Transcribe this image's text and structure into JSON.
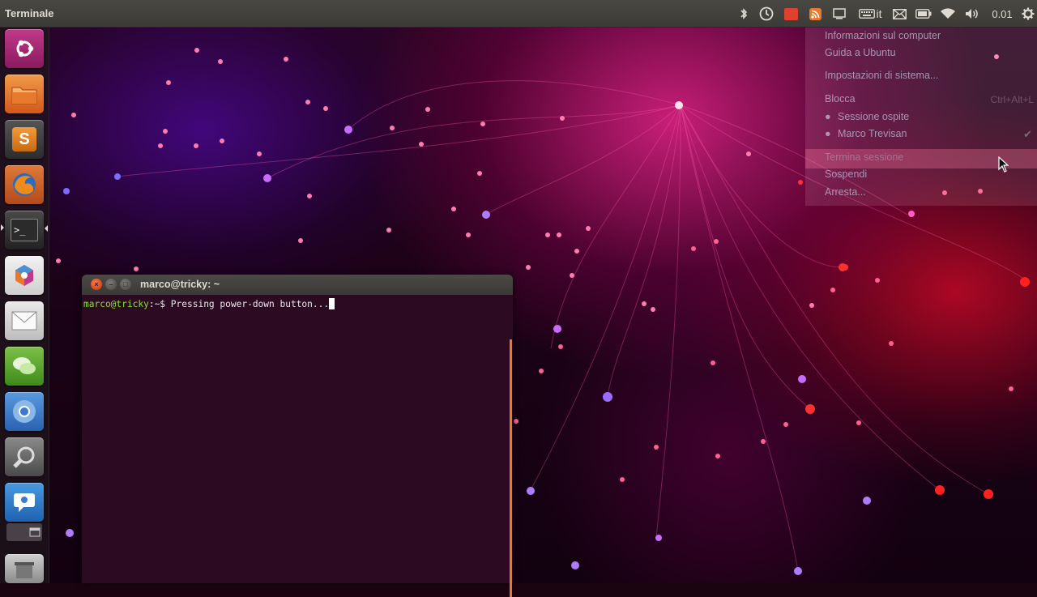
{
  "panel": {
    "app_title": "Terminale",
    "keyboard_layout": "it",
    "clock": "0.01"
  },
  "launcher": {
    "items": [
      {
        "name": "dash-home",
        "icon": "ubuntu-logo-icon"
      },
      {
        "name": "home-folder",
        "icon": "folder-icon"
      },
      {
        "name": "sublime-text",
        "icon": "sublime-s-icon",
        "glyph": "S"
      },
      {
        "name": "firefox",
        "icon": "firefox-icon"
      },
      {
        "name": "terminal",
        "icon": "terminal-icon",
        "glyph": ">_"
      },
      {
        "name": "software-center",
        "icon": "software-center-icon"
      },
      {
        "name": "mail",
        "icon": "envelope-icon"
      },
      {
        "name": "chat",
        "icon": "chat-bubbles-icon"
      },
      {
        "name": "chromium",
        "icon": "chromium-icon"
      },
      {
        "name": "system-settings",
        "icon": "wrench-icon"
      },
      {
        "name": "messaging",
        "icon": "message-icon"
      },
      {
        "name": "workspaces",
        "icon": "workspace-icon"
      },
      {
        "name": "trash",
        "icon": "trash-icon"
      }
    ]
  },
  "terminal": {
    "title": "marco@tricky: ~",
    "prompt_user": "marco@tricky",
    "prompt_path": ":~$ ",
    "command_text": "Pressing power-down button..."
  },
  "session_menu": {
    "items": [
      {
        "label": "Informazioni sul computer"
      },
      {
        "label": "Guida a Ubuntu"
      },
      {
        "label": "Impostazioni di sistema..."
      },
      {
        "label": "Blocca"
      },
      {
        "label": "Sessione ospite"
      },
      {
        "label": "Marco Trevisan"
      },
      {
        "label": "Termina sessione"
      },
      {
        "label": "Sospendi"
      },
      {
        "label": "Arresta..."
      }
    ],
    "lock_shortcut": "Ctrl+Alt+L",
    "highlighted_item": "Termina sessione"
  },
  "colors": {
    "panel_bg": "#3c3b37",
    "terminal_bg": "#2c0a21",
    "prompt_green": "#8ae234",
    "close_orange": "#d8461b",
    "scroll_orange": "#e9782b"
  }
}
